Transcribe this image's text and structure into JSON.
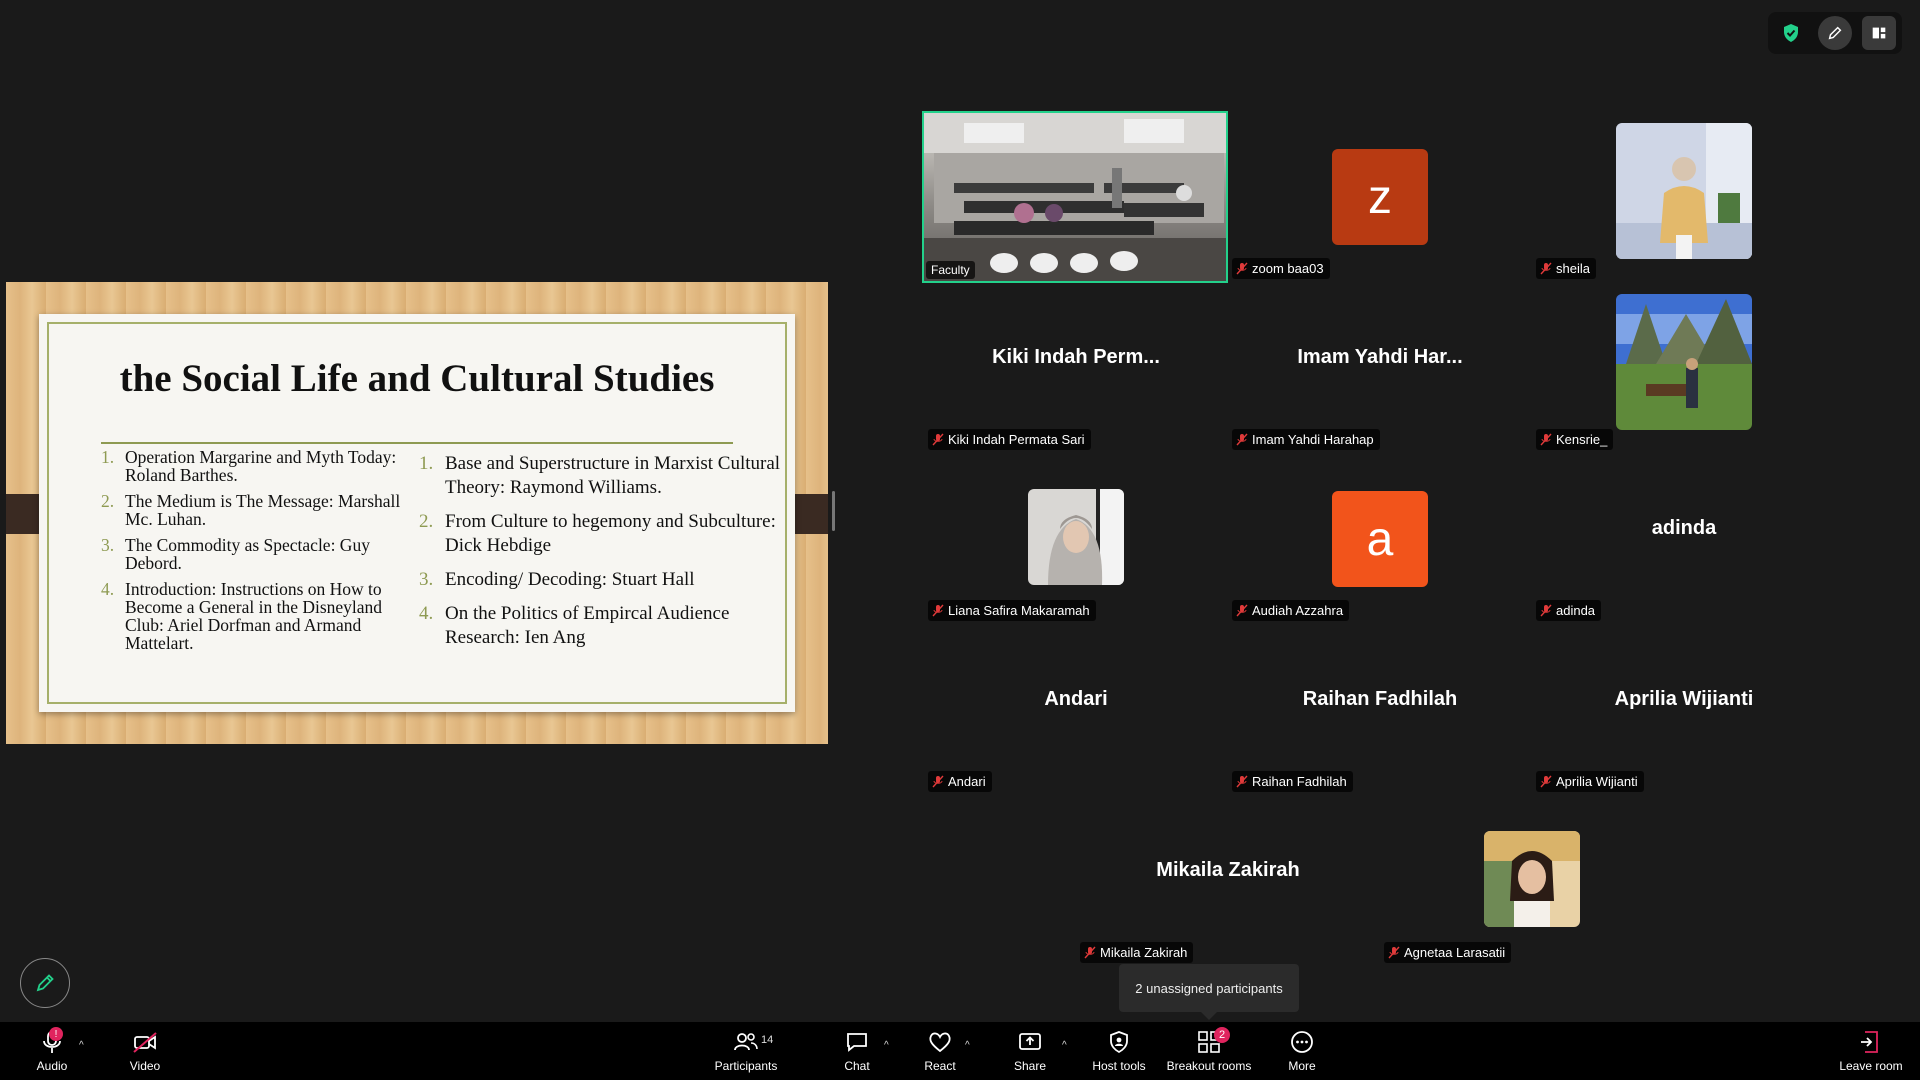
{
  "top_controls": {
    "shield": "shield-check-icon",
    "pen": "pen-icon",
    "layout": "layout-icon",
    "shield_color": "#23d18b"
  },
  "slide": {
    "title": "the Social Life and Cultural Studies",
    "left_list": [
      {
        "num": "1.",
        "text": "Operation Margarine and Myth Today: Roland Barthes."
      },
      {
        "num": "2.",
        "text": "The Medium is The Message: Marshall Mc. Luhan."
      },
      {
        "num": "3.",
        "text": "The Commodity as Spectacle: Guy Debord."
      },
      {
        "num": "4.",
        "text": "Introduction: Instructions on How to Become a General in the Disneyland Club: Ariel Dorfman and Armand Mattelart."
      }
    ],
    "right_list": [
      {
        "num": "1.",
        "text": "Base and Superstructure in Marxist Cultural Theory: Raymond Williams."
      },
      {
        "num": "2.",
        "text": "From Culture to hegemony and Subculture: Dick Hebdige"
      },
      {
        "num": "3.",
        "text": "Encoding/ Decoding: Stuart Hall"
      },
      {
        "num": "4.",
        "text": "On the Politics of Empircal Audience Research: Ien Ang"
      }
    ]
  },
  "participants": {
    "faculty": "Faculty",
    "zoom_baa03": {
      "letter": "z",
      "name": "zoom baa03",
      "color": "#b83a12"
    },
    "sheila": "sheila",
    "kiki": {
      "big": "Kiki Indah Perm...",
      "name": "Kiki Indah Permata Sari"
    },
    "imam": {
      "big": "Imam Yahdi Har...",
      "name": "Imam Yahdi Harahap"
    },
    "kensrie": "Kensrie_",
    "liana": "Liana Safira Makaramah",
    "audiah": {
      "letter": "a",
      "name": "Audiah Azzahra",
      "color": "#f2541b"
    },
    "adinda": {
      "big": "adinda",
      "name": "adinda"
    },
    "andari": {
      "big": "Andari",
      "name": "Andari"
    },
    "raihan": {
      "big": "Raihan Fadhilah",
      "name": "Raihan Fadhilah"
    },
    "aprilia": {
      "big": "Aprilia Wijianti",
      "name": "Aprilia Wijianti"
    },
    "mikaila": {
      "big": "Mikaila Zakirah",
      "name": "Mikaila Zakirah"
    },
    "agnetaa": "Agnetaa Larasatii"
  },
  "tooltip": "2 unassigned participants",
  "toolbar": {
    "audio": "Audio",
    "video": "Video",
    "participants": "Participants",
    "participants_count": "14",
    "chat": "Chat",
    "react": "React",
    "share": "Share",
    "host_tools": "Host tools",
    "breakout_rooms": "Breakout rooms",
    "breakout_badge": "2",
    "more": "More",
    "leave": "Leave room",
    "audio_badge": "!",
    "alert_color": "#e0245e"
  }
}
